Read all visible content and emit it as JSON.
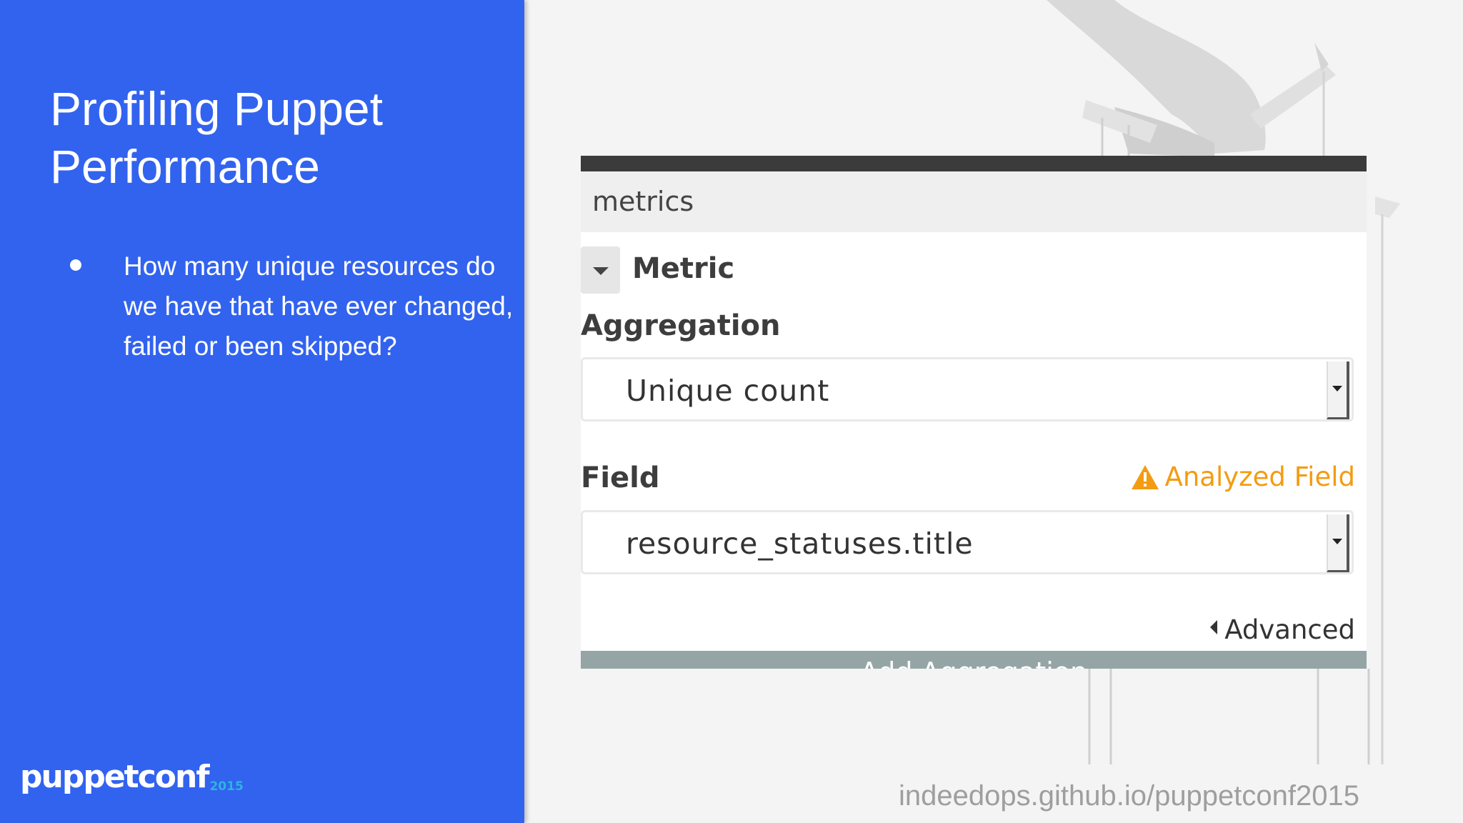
{
  "slide": {
    "title_line1": "Profiling Puppet",
    "title_line2": "Performance",
    "bullets": [
      "How many unique resources do we have that have ever changed, failed or been skipped?"
    ],
    "logo_text": "puppetconf",
    "logo_year": "2015",
    "url": "indeedops.github.io/puppetconf2015"
  },
  "panel": {
    "header": "metrics",
    "section_label": "Metric",
    "aggregation_label": "Aggregation",
    "aggregation_value": "Unique count",
    "field_label": "Field",
    "field_warning": "Analyzed Field",
    "field_value": "resource_statuses.title",
    "advanced_label": "Advanced",
    "add_button_label": "Add Aggregation"
  },
  "colors": {
    "panel_blue": "#3263ef",
    "warning_orange": "#f39c11",
    "button_gray": "#95a5a6",
    "topbar_dark": "#3b3b3b"
  },
  "icons": [
    "collapse-caret-icon",
    "warning-triangle-icon",
    "select-arrow-icon",
    "advanced-caret-icon"
  ]
}
